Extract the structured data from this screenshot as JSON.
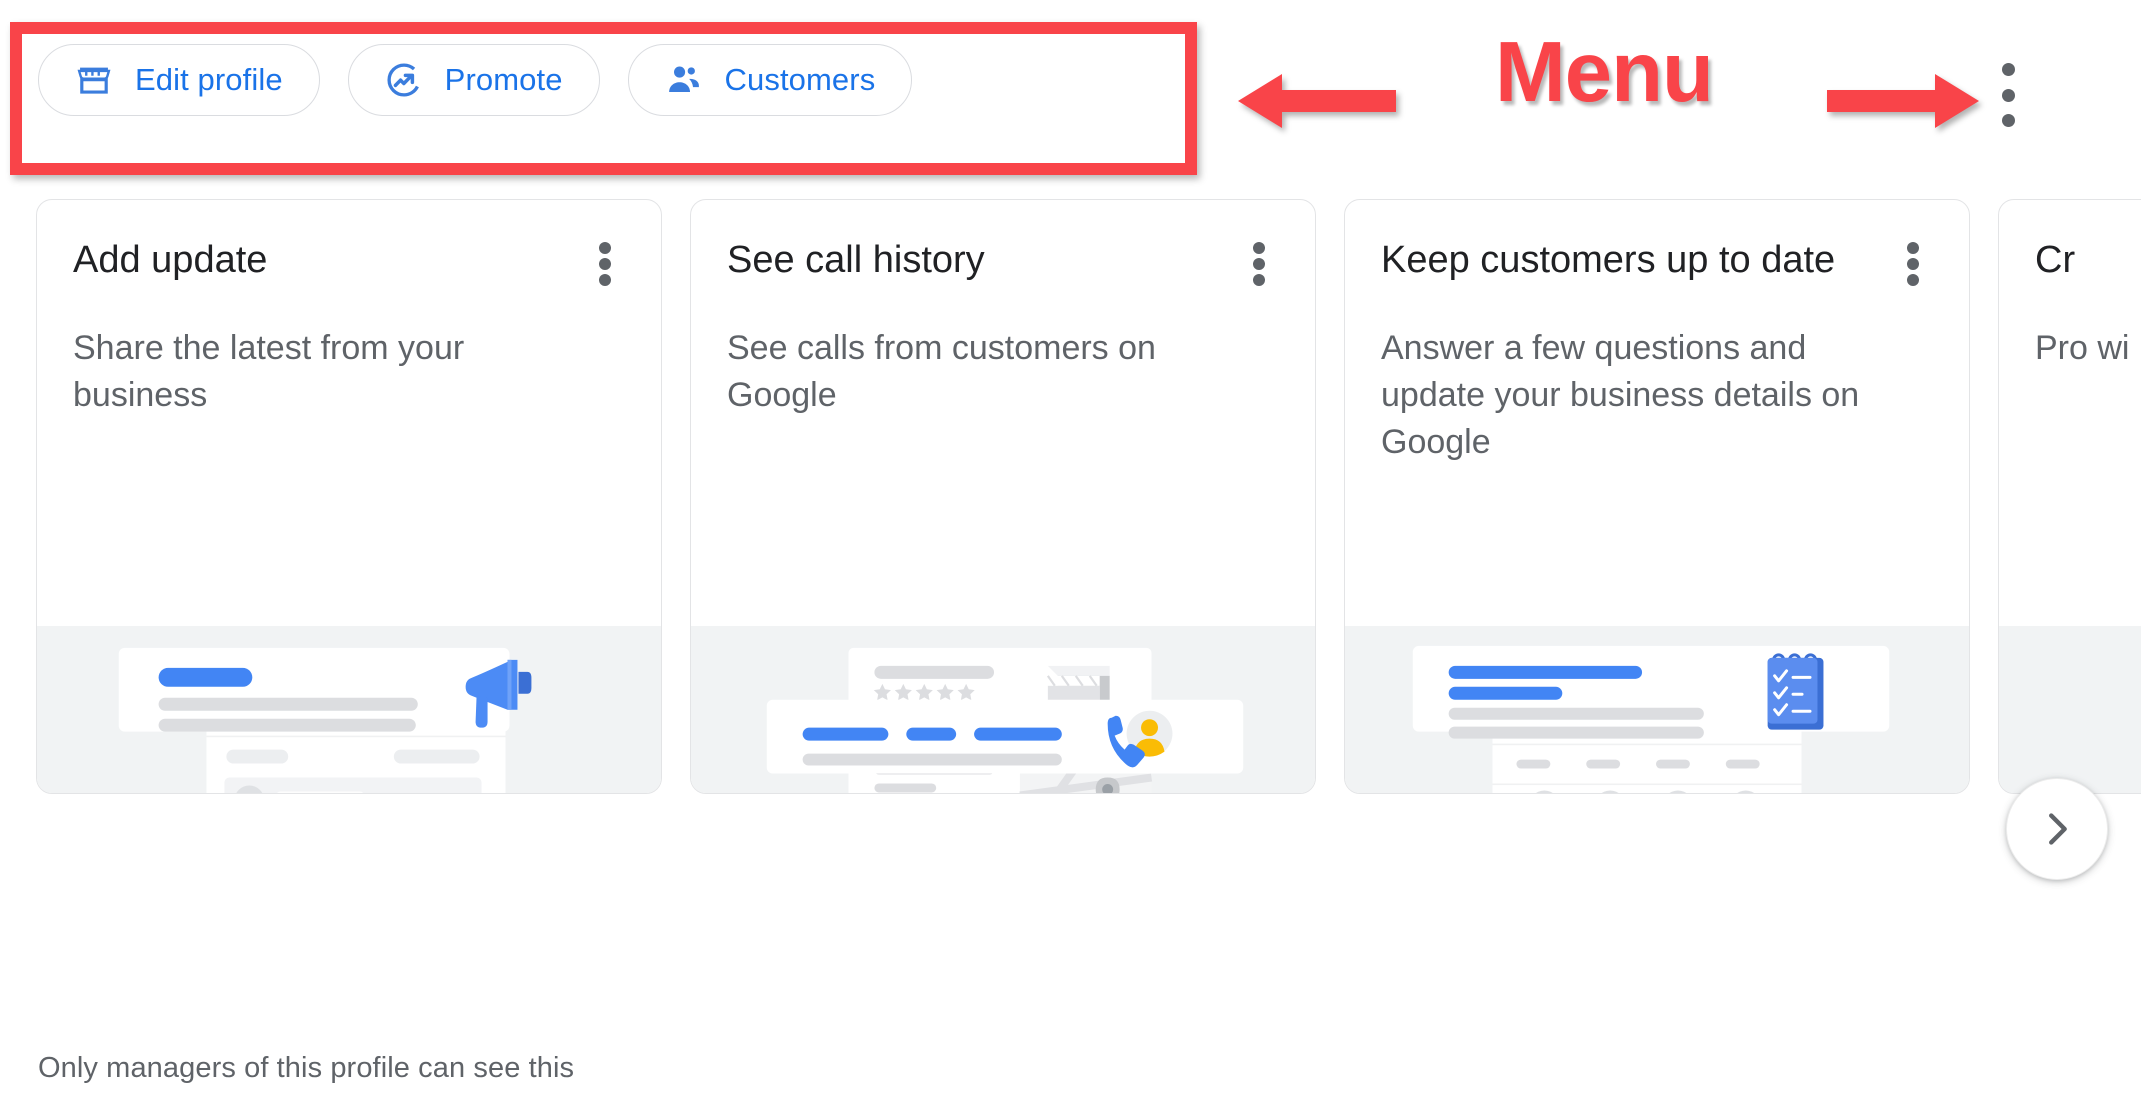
{
  "colors": {
    "accent_blue": "#1a73e8",
    "illustration_blue": "#4c8bf5",
    "illustration_yellow": "#fabc05",
    "annotation_red": "#f94449",
    "text_primary": "#202124",
    "text_secondary": "#5f6368",
    "card_border": "#e3e4e6",
    "illustration_bg": "#f1f3f4"
  },
  "action_chips": [
    {
      "label": "Edit profile",
      "icon": "storefront-icon"
    },
    {
      "label": "Promote",
      "icon": "trending-up-circle-icon"
    },
    {
      "label": "Customers",
      "icon": "people-icon"
    }
  ],
  "annotation": {
    "menu_label": "Menu",
    "left_arrow_icon": "left-arrow-annotation-icon",
    "right_arrow_icon": "right-arrow-annotation-icon",
    "box_icon": "red-highlight-box"
  },
  "header": {
    "overflow_menu_icon": "more-vert-icon"
  },
  "carousel": {
    "next_button_icon": "chevron-right-icon",
    "card_overflow_icon": "more-vert-icon",
    "cards": [
      {
        "title": "Add update",
        "description": "Share the latest from your business",
        "illustration": "post-update-megaphone-illustration"
      },
      {
        "title": "See call history",
        "description": "See calls from customers on Google",
        "illustration": "call-history-phone-illustration"
      },
      {
        "title": "Keep customers up to date",
        "description": "Answer a few questions and update your business details on Google",
        "illustration": "business-info-checklist-illustration"
      },
      {
        "title": "Cr",
        "description": "Pro wi",
        "illustration": "partial-card-illustration"
      }
    ]
  },
  "footer": {
    "note": "Only managers of this profile can see this"
  }
}
